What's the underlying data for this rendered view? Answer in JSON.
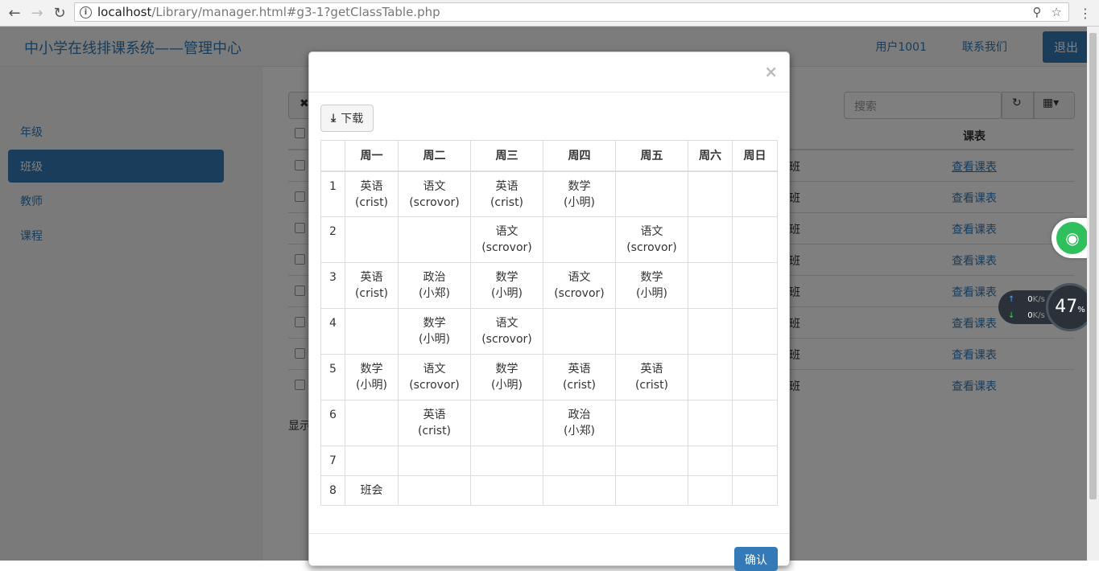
{
  "browser": {
    "url_host": "localhost",
    "url_path": "/Library/manager.html#g3-1?getClassTable.php"
  },
  "navbar": {
    "brand": "中小学在线排课系统——管理中心",
    "user": "用户1001",
    "contact": "联系我们",
    "logout": "退出"
  },
  "sidebar": {
    "items": [
      {
        "label": "年级"
      },
      {
        "label": "班级",
        "active": true
      },
      {
        "label": "教师"
      },
      {
        "label": "课程"
      }
    ]
  },
  "background_table": {
    "search_placeholder": "搜索",
    "col_schedule": "课表",
    "rows": [
      {
        "class": "班",
        "link": "查看课表"
      },
      {
        "class": "班",
        "link": "查看课表"
      },
      {
        "class": "班",
        "link": "查看课表"
      },
      {
        "class": "班",
        "link": "查看课表"
      },
      {
        "class": "班",
        "link": "查看课表"
      },
      {
        "class": "班",
        "link": "查看课表"
      },
      {
        "class": "班",
        "link": "查看课表"
      },
      {
        "class": "班",
        "link": "查看课表"
      }
    ],
    "footer_text": "显示"
  },
  "modal": {
    "close": "×",
    "download": "下载",
    "ok": "确认",
    "days": [
      "周一",
      "周二",
      "周三",
      "周四",
      "周五",
      "周六",
      "周日"
    ],
    "periods": [
      {
        "n": "1",
        "cells": [
          [
            "英语",
            "(crist)"
          ],
          [
            "语文",
            "(scrovor)"
          ],
          [
            "英语",
            "(crist)"
          ],
          [
            "数学",
            "(小明)"
          ],
          [
            "",
            ""
          ],
          [
            "",
            ""
          ],
          [
            "",
            ""
          ]
        ]
      },
      {
        "n": "2",
        "cells": [
          [
            "",
            ""
          ],
          [
            "",
            ""
          ],
          [
            "语文",
            "(scrovor)"
          ],
          [
            "",
            ""
          ],
          [
            "语文",
            "(scrovor)"
          ],
          [
            "",
            ""
          ],
          [
            "",
            ""
          ]
        ]
      },
      {
        "n": "3",
        "cells": [
          [
            "英语",
            "(crist)"
          ],
          [
            "政治",
            "(小郑)"
          ],
          [
            "数学",
            "(小明)"
          ],
          [
            "语文",
            "(scrovor)"
          ],
          [
            "数学",
            "(小明)"
          ],
          [
            "",
            ""
          ],
          [
            "",
            ""
          ]
        ]
      },
      {
        "n": "4",
        "cells": [
          [
            "",
            ""
          ],
          [
            "数学",
            "(小明)"
          ],
          [
            "语文",
            "(scrovor)"
          ],
          [
            "",
            ""
          ],
          [
            "",
            ""
          ],
          [
            "",
            ""
          ],
          [
            "",
            ""
          ]
        ]
      },
      {
        "n": "5",
        "cells": [
          [
            "数学",
            "(小明)"
          ],
          [
            "语文",
            "(scrovor)"
          ],
          [
            "数学",
            "(小明)"
          ],
          [
            "英语",
            "(crist)"
          ],
          [
            "英语",
            "(crist)"
          ],
          [
            "",
            ""
          ],
          [
            "",
            ""
          ]
        ]
      },
      {
        "n": "6",
        "cells": [
          [
            "",
            ""
          ],
          [
            "英语",
            "(crist)"
          ],
          [
            "",
            ""
          ],
          [
            "政治",
            "(小郑)"
          ],
          [
            "",
            ""
          ],
          [
            "",
            ""
          ],
          [
            "",
            ""
          ]
        ]
      },
      {
        "n": "7",
        "cells": [
          [
            "",
            ""
          ],
          [
            "",
            ""
          ],
          [
            "",
            ""
          ],
          [
            "",
            ""
          ],
          [
            "",
            ""
          ],
          [
            "",
            ""
          ],
          [
            "",
            ""
          ]
        ]
      },
      {
        "n": "8",
        "cells": [
          [
            "班会",
            ""
          ],
          [
            "",
            ""
          ],
          [
            "",
            ""
          ],
          [
            "",
            ""
          ],
          [
            "",
            ""
          ],
          [
            "",
            ""
          ],
          [
            "",
            ""
          ]
        ]
      }
    ]
  },
  "widgets": {
    "upload": "0",
    "download": "0",
    "speed_unit": "K/s",
    "gauge_value": "47",
    "gauge_unit": "%"
  }
}
